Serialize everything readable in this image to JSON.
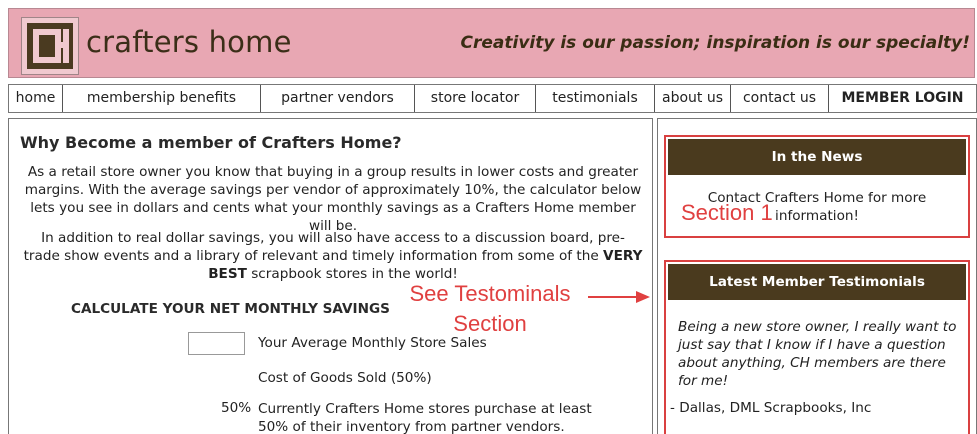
{
  "header": {
    "logo_letters": "CH",
    "site_name": "crafters home",
    "tagline": "Creativity is our passion; inspiration is our specialty!"
  },
  "nav": {
    "items": [
      {
        "label": "home"
      },
      {
        "label": "membership benefits"
      },
      {
        "label": "partner vendors"
      },
      {
        "label": "store locator"
      },
      {
        "label": "testimonials"
      },
      {
        "label": "about us"
      },
      {
        "label": "contact us"
      },
      {
        "label": "MEMBER LOGIN"
      }
    ]
  },
  "main": {
    "title": "Why Become a member of Crafters Home?",
    "paragraph1": "As a retail store owner you know that buying in a group results in lower costs and greater margins.  With the average savings per vendor of approximately 10%, the calculator below lets you see in dollars and cents what your monthly savings as a Crafters Home member will be.",
    "paragraph2_start": "In addition to real dollar savings, you will also have access to a discussion board, pre-trade show events and a library of relevant and timely information from some of the ",
    "paragraph2_bold": "VERY BEST",
    "paragraph2_end": " scrapbook stores in the world!",
    "calculator": {
      "title": "CALCULATE YOUR NET MONTHLY SAVINGS",
      "sales_input_value": "",
      "sales_label": "Your Average Monthly Store Sales",
      "cogs_label": "Cost of Goods Sold (50%)",
      "purchase_pct": "50%",
      "purchase_label": "Currently Crafters Home stores purchase at least 50% of their inventory from partner vendors."
    }
  },
  "sidebar": {
    "news": {
      "heading": "In the News",
      "body": "Contact Crafters Home for more information!"
    },
    "testimonials": {
      "heading": "Latest Member Testimonials",
      "quote": "Being a new store owner, I really want to just say that I know if I have a question about anything, CH members are there for me!",
      "author": "- Dallas, DML Scrapbooks, Inc"
    }
  },
  "annotations": {
    "section1": "Section 1",
    "see_testimonials": "See Testominals Section",
    "color": "#e04040"
  },
  "colors": {
    "header_bg": "#e8a7b3",
    "brand_brown": "#4a3a1e",
    "highlight_red": "#d94040"
  }
}
